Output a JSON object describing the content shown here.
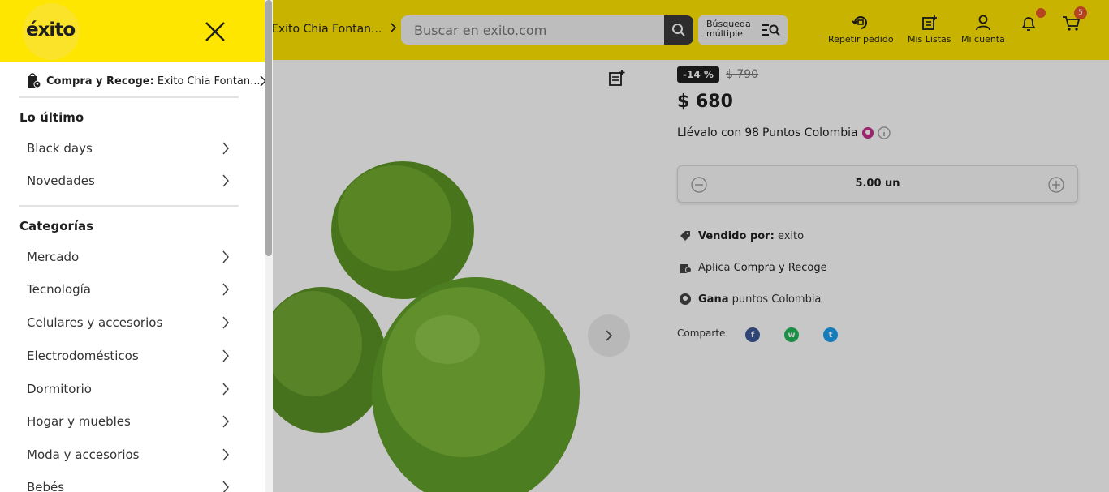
{
  "header": {
    "store_selector": "Exito Chia Fontan...",
    "search_placeholder": "Buscar en exito.com",
    "multi_search_line1": "Búsqueda",
    "multi_search_line2": "múltiple",
    "repeat_order": "Repetir pedido",
    "my_lists": "Mis Listas",
    "my_account": "Mi cuenta",
    "cart_count": "5"
  },
  "product": {
    "discount": "-14 %",
    "old_price": "$ 790",
    "price": "$ 680",
    "points_prefix": "Llévalo con",
    "points_value": "98",
    "points_suffix": "Puntos Colombia",
    "quantity": "5.00 un",
    "sold_by_label": "Vendido por:",
    "sold_by_value": "exito",
    "applies_label": "Aplica",
    "applies_value": "Compra y Recoge",
    "earn_label": "Gana",
    "earn_value": "puntos Colombia",
    "share_label": "Comparte:"
  },
  "drawer": {
    "logo": "éxito",
    "pickup_label": "Compra y Recoge:",
    "pickup_store": "Exito Chia Fontan...",
    "latest_title": "Lo último",
    "latest_items": [
      "Black days",
      "Novedades"
    ],
    "categories_title": "Categorías",
    "category_items": [
      "Mercado",
      "Tecnología",
      "Celulares y accesorios",
      "Electrodomésticos",
      "Dormitorio",
      "Hogar y muebles",
      "Moda y accesorios",
      "Bebés"
    ]
  },
  "colors": {
    "brand_yellow": "#ffe600",
    "badge_orange": "#e8572b",
    "dark": "#1f1f1f"
  }
}
